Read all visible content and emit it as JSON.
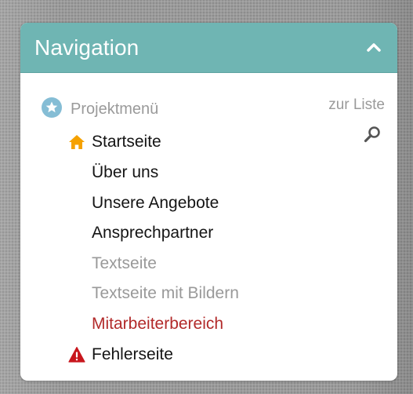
{
  "panel": {
    "title": "Navigation",
    "collapse_icon": "chevron-up-icon",
    "header_color": "#6fb5b3"
  },
  "menu": {
    "header_icon": "star-icon",
    "header_label": "Projektmenü",
    "list_link": "zur Liste",
    "search_icon": "search-icon",
    "items": [
      {
        "label": "Startseite",
        "icon": "home-icon",
        "state": "normal"
      },
      {
        "label": "Über uns",
        "state": "normal"
      },
      {
        "label": "Unsere Angebote",
        "state": "normal"
      },
      {
        "label": "Ansprechpartner",
        "state": "normal"
      },
      {
        "label": "Textseite",
        "state": "muted"
      },
      {
        "label": "Textseite mit Bildern",
        "state": "muted"
      },
      {
        "label": "Mitarbeiterbereich",
        "state": "restricted"
      },
      {
        "label": "Fehlerseite",
        "icon": "warning-icon",
        "state": "normal"
      }
    ]
  },
  "colors": {
    "home_icon": "#f5a100",
    "warning_icon": "#c8161d",
    "restricted_text": "#b22a2a",
    "muted_text": "#999999",
    "star_badge": "#85bdd5"
  }
}
